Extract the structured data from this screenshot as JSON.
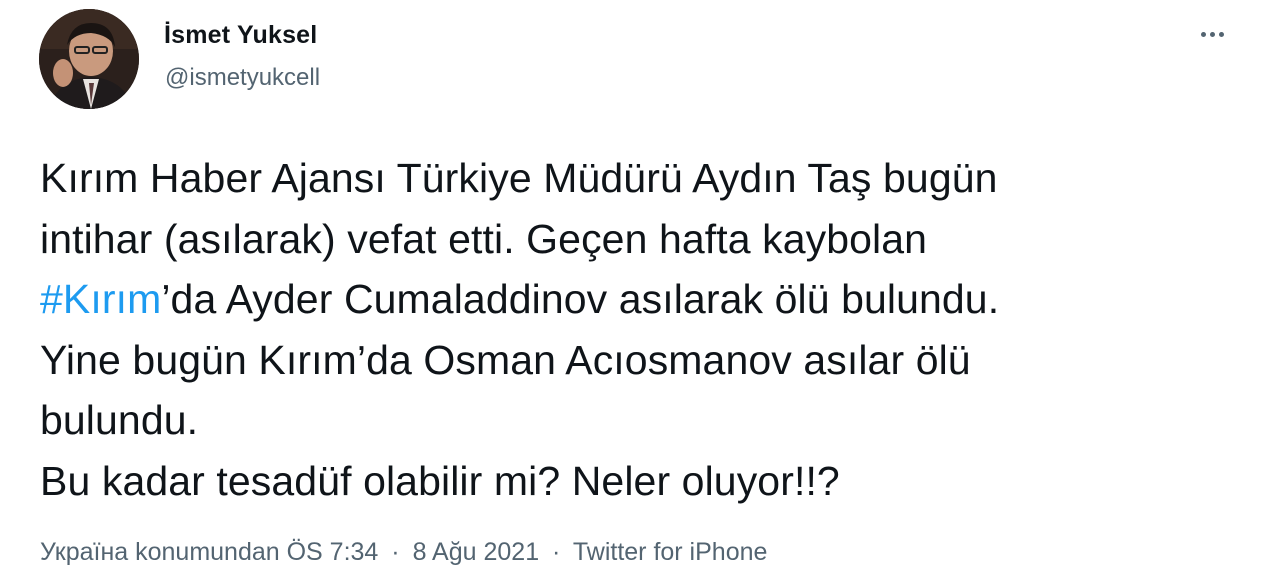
{
  "author": {
    "display_name": "İsmet Yuksel",
    "handle": "@ismetyukcell",
    "avatar_icon": "profile-photo"
  },
  "more_icon": "more-horizontal-icon",
  "tweet": {
    "line1": "Kırım Haber Ajansı Türkiye Müdürü Aydın Taş bugün",
    "line2": "intihar (asılarak) vefat etti. Geçen hafta kaybolan",
    "line3_hashtag": "#Kırım",
    "line3_rest": "’da Ayder Cumaladdinov asılarak ölü bulundu.",
    "line4": "Yine bugün Kırım’da Osman Acıosmanov asılar ölü",
    "line5": "bulundu.",
    "line6": "Bu kadar tesadüf olabilir mi? Neler oluyor!!?"
  },
  "meta": {
    "location_time": "Україна konumundan ÖS 7:34",
    "separator": "·",
    "date": "8 Ağu 2021",
    "source": "Twitter for iPhone"
  },
  "colors": {
    "text": "#0f1419",
    "secondary": "#536471",
    "link": "#1d9bf0"
  }
}
